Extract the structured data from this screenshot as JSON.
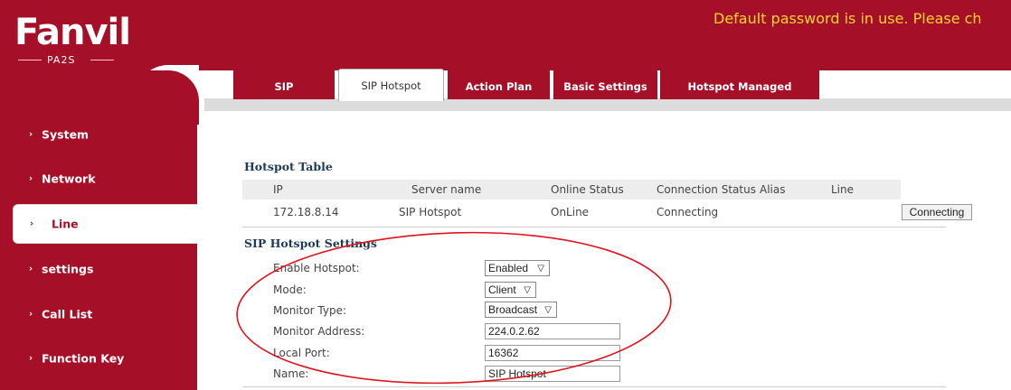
{
  "header": {
    "logo_text": "Fanvil",
    "model": "PA2S",
    "warning": "Default password is in use. Please ch"
  },
  "sidebar": {
    "items": [
      {
        "label": "System"
      },
      {
        "label": "Network"
      },
      {
        "label": "Line"
      },
      {
        "label": "settings"
      },
      {
        "label": "Call List"
      },
      {
        "label": "Function Key"
      }
    ]
  },
  "tabs": [
    {
      "label": "SIP"
    },
    {
      "label": "SIP Hotspot"
    },
    {
      "label": "Action Plan"
    },
    {
      "label": "Basic Settings"
    },
    {
      "label": "Hotspot Managed Extension"
    }
  ],
  "hotspot_table": {
    "title": "Hotspot Table",
    "columns": [
      "IP",
      "Server name",
      "Online Status",
      "Connection Status",
      "Alias",
      "Line"
    ],
    "rows": [
      {
        "ip": "172.18.8.14",
        "server_name": "SIP Hotspot",
        "online_status": "OnLine",
        "connection_status": "Connecting",
        "alias": "",
        "line": "",
        "action": "Connecting"
      }
    ]
  },
  "settings": {
    "title": "SIP Hotspot Settings",
    "enable_hotspot": {
      "label": "Enable Hotspot:",
      "value": "Enabled"
    },
    "mode": {
      "label": "Mode:",
      "value": "Client"
    },
    "monitor_type": {
      "label": "Monitor Type:",
      "value": "Broadcast"
    },
    "monitor_address": {
      "label": "Monitor Address:",
      "value": "224.0.2.62"
    },
    "local_port": {
      "label": "Local Port:",
      "value": "16362"
    },
    "name": {
      "label": "Name:",
      "value": "SIP Hotspot"
    }
  },
  "colors": {
    "brand_red": "#a50f27",
    "warning_yellow": "#ffd52e",
    "annotation_red": "#e0141e"
  }
}
